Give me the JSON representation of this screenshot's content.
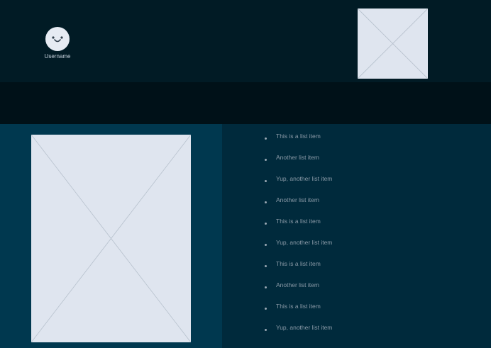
{
  "header": {
    "username": "Username",
    "avatar_icon": "smiley-face-icon",
    "image_icon": "image-placeholder-icon"
  },
  "main": {
    "image_icon": "image-placeholder-icon"
  },
  "list": {
    "items": [
      "This is a list item",
      "Another list item",
      "Yup, another list item",
      "Another list item",
      "This is a list item",
      "Yup, another list item",
      "This is a list item",
      "Another list item",
      "This is a list item",
      "Yup, another list item"
    ]
  },
  "colors": {
    "header_bg": "#011b25",
    "band_bg": "#001118",
    "left_panel_bg": "#00384f",
    "right_panel_bg": "#002a3c",
    "placeholder_bg": "#dfe5ef"
  }
}
